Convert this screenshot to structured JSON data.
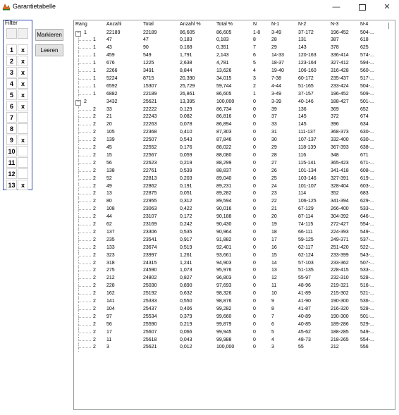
{
  "window": {
    "title": "Garantietabelle",
    "minimize": "—",
    "close": "✕"
  },
  "filter": {
    "caption": "Filter",
    "rows": [
      {
        "num": "1",
        "mark": "x"
      },
      {
        "num": "2",
        "mark": "x"
      },
      {
        "num": "3",
        "mark": "x"
      },
      {
        "num": "4",
        "mark": "x"
      },
      {
        "num": "5",
        "mark": "x"
      },
      {
        "num": "6",
        "mark": "x"
      },
      {
        "num": "7",
        "mark": ""
      },
      {
        "num": "8",
        "mark": ""
      },
      {
        "num": "9",
        "mark": "x"
      },
      {
        "num": "10",
        "mark": ""
      },
      {
        "num": "11",
        "mark": ""
      },
      {
        "num": "12",
        "mark": ""
      },
      {
        "num": "13",
        "mark": "x"
      }
    ]
  },
  "buttons": {
    "markieren": "Markieren",
    "leeren": "Leeren"
  },
  "table": {
    "columns": [
      "Rang",
      "Anzahl",
      "Total",
      "Anzahl %",
      "Total %",
      "N",
      "N-1",
      "N-2",
      "N-3",
      "N-4"
    ],
    "rows": [
      {
        "level": 0,
        "exp": "-",
        "rang": "1",
        "anzahl": "22189",
        "total": "22189",
        "ap": "86,605",
        "tp": "86,605",
        "n": "1-8",
        "n1": "3-49",
        "n2": "37-172",
        "n3": "196-452",
        "n4": "504-..."
      },
      {
        "level": 1,
        "rang": "1",
        "anzahl": "47",
        "total": "47",
        "ap": "0,183",
        "tp": "0,183",
        "n": "8",
        "n1": "28",
        "n2": "131",
        "n3": "387",
        "n4": "618"
      },
      {
        "level": 1,
        "rang": "1",
        "anzahl": "43",
        "total": "90",
        "ap": "0,168",
        "tp": "0,351",
        "n": "7",
        "n1": "29",
        "n2": "143",
        "n3": "378",
        "n4": "625"
      },
      {
        "level": 1,
        "rang": "1",
        "anzahl": "459",
        "total": "549",
        "ap": "1,791",
        "tp": "2,143",
        "n": "6",
        "n1": "14-33",
        "n2": "120-163",
        "n3": "336-414",
        "n4": "574-..."
      },
      {
        "level": 1,
        "rang": "1",
        "anzahl": "676",
        "total": "1225",
        "ap": "2,638",
        "tp": "4,781",
        "n": "5",
        "n1": "18-37",
        "n2": "123-164",
        "n3": "327-412",
        "n4": "594-..."
      },
      {
        "level": 1,
        "rang": "1",
        "anzahl": "2266",
        "total": "3491",
        "ap": "8,844",
        "tp": "13,626",
        "n": "4",
        "n1": "19-40",
        "n2": "106-160",
        "n3": "316-428",
        "n4": "560-..."
      },
      {
        "level": 1,
        "rang": "1",
        "anzahl": "5224",
        "total": "8715",
        "ap": "20,390",
        "tp": "34,015",
        "n": "3",
        "n1": "7-38",
        "n2": "60-172",
        "n3": "235-437",
        "n4": "517-..."
      },
      {
        "level": 1,
        "rang": "1",
        "anzahl": "6592",
        "total": "15307",
        "ap": "25,729",
        "tp": "59,744",
        "n": "2",
        "n1": "4-44",
        "n2": "51-165",
        "n3": "233-424",
        "n4": "504-..."
      },
      {
        "level": 1,
        "rang": "1",
        "anzahl": "6882",
        "total": "22189",
        "ap": "26,861",
        "tp": "86,605",
        "n": "1",
        "n1": "3-49",
        "n2": "37-157",
        "n3": "196-452",
        "n4": "509-..."
      },
      {
        "level": 0,
        "exp": "-",
        "rang": "2",
        "anzahl": "3432",
        "total": "25621",
        "ap": "13,395",
        "tp": "100,000",
        "n": "0",
        "n1": "3-39",
        "n2": "40-146",
        "n3": "188-427",
        "n4": "501-..."
      },
      {
        "level": 1,
        "rang": "2",
        "anzahl": "33",
        "total": "22222",
        "ap": "0,129",
        "tp": "86,734",
        "n": "0",
        "n1": "39",
        "n2": "136",
        "n3": "369",
        "n4": "652"
      },
      {
        "level": 1,
        "rang": "2",
        "anzahl": "21",
        "total": "22243",
        "ap": "0,082",
        "tp": "86,816",
        "n": "0",
        "n1": "37",
        "n2": "145",
        "n3": "372",
        "n4": "674"
      },
      {
        "level": 1,
        "rang": "2",
        "anzahl": "20",
        "total": "22263",
        "ap": "0,078",
        "tp": "86,894",
        "n": "0",
        "n1": "33",
        "n2": "145",
        "n3": "396",
        "n4": "634"
      },
      {
        "level": 1,
        "rang": "2",
        "anzahl": "105",
        "total": "22368",
        "ap": "0,410",
        "tp": "87,303",
        "n": "0",
        "n1": "31",
        "n2": "111-137",
        "n3": "368-373",
        "n4": "630-..."
      },
      {
        "level": 1,
        "rang": "2",
        "anzahl": "139",
        "total": "22507",
        "ap": "0,543",
        "tp": "87,846",
        "n": "0",
        "n1": "30",
        "n2": "107-137",
        "n3": "332-400",
        "n4": "630-..."
      },
      {
        "level": 1,
        "rang": "2",
        "anzahl": "45",
        "total": "22552",
        "ap": "0,176",
        "tp": "88,022",
        "n": "0",
        "n1": "29",
        "n2": "118-139",
        "n3": "367-393",
        "n4": "638-..."
      },
      {
        "level": 1,
        "rang": "2",
        "anzahl": "15",
        "total": "22567",
        "ap": "0,059",
        "tp": "88,080",
        "n": "0",
        "n1": "28",
        "n2": "116",
        "n3": "348",
        "n4": "671"
      },
      {
        "level": 1,
        "rang": "2",
        "anzahl": "56",
        "total": "22623",
        "ap": "0,219",
        "tp": "88,299",
        "n": "0",
        "n1": "27",
        "n2": "115-141",
        "n3": "365-423",
        "n4": "671-..."
      },
      {
        "level": 1,
        "rang": "2",
        "anzahl": "138",
        "total": "22761",
        "ap": "0,539",
        "tp": "88,837",
        "n": "0",
        "n1": "26",
        "n2": "101-134",
        "n3": "341-418",
        "n4": "608-..."
      },
      {
        "level": 1,
        "rang": "2",
        "anzahl": "52",
        "total": "22813",
        "ap": "0,203",
        "tp": "89,040",
        "n": "0",
        "n1": "25",
        "n2": "103-146",
        "n3": "327-391",
        "n4": "619-..."
      },
      {
        "level": 1,
        "rang": "2",
        "anzahl": "49",
        "total": "22862",
        "ap": "0,191",
        "tp": "89,231",
        "n": "0",
        "n1": "24",
        "n2": "101-107",
        "n3": "328-404",
        "n4": "603-..."
      },
      {
        "level": 1,
        "rang": "2",
        "anzahl": "13",
        "total": "22875",
        "ap": "0,051",
        "tp": "89,282",
        "n": "0",
        "n1": "23",
        "n2": "114",
        "n3": "352",
        "n4": "683"
      },
      {
        "level": 1,
        "rang": "2",
        "anzahl": "80",
        "total": "22955",
        "ap": "0,312",
        "tp": "89,594",
        "n": "0",
        "n1": "22",
        "n2": "106-125",
        "n3": "341-394",
        "n4": "629-..."
      },
      {
        "level": 1,
        "rang": "2",
        "anzahl": "108",
        "total": "23063",
        "ap": "0,422",
        "tp": "90,016",
        "n": "0",
        "n1": "21",
        "n2": "67-129",
        "n3": "266-400",
        "n4": "533-..."
      },
      {
        "level": 1,
        "rang": "2",
        "anzahl": "44",
        "total": "23107",
        "ap": "0,172",
        "tp": "90,188",
        "n": "0",
        "n1": "20",
        "n2": "87-114",
        "n3": "304-392",
        "n4": "646-..."
      },
      {
        "level": 1,
        "rang": "2",
        "anzahl": "62",
        "total": "23169",
        "ap": "0,242",
        "tp": "90,430",
        "n": "0",
        "n1": "19",
        "n2": "74-115",
        "n3": "272-427",
        "n4": "554-..."
      },
      {
        "level": 1,
        "rang": "2",
        "anzahl": "137",
        "total": "23306",
        "ap": "0,535",
        "tp": "90,964",
        "n": "0",
        "n1": "18",
        "n2": "66-111",
        "n3": "224-393",
        "n4": "549-..."
      },
      {
        "level": 1,
        "rang": "2",
        "anzahl": "235",
        "total": "23541",
        "ap": "0,917",
        "tp": "91,882",
        "n": "0",
        "n1": "17",
        "n2": "59-125",
        "n3": "249-371",
        "n4": "537-..."
      },
      {
        "level": 1,
        "rang": "2",
        "anzahl": "133",
        "total": "23674",
        "ap": "0,519",
        "tp": "92,401",
        "n": "0",
        "n1": "16",
        "n2": "62-117",
        "n3": "251-420",
        "n4": "522-..."
      },
      {
        "level": 1,
        "rang": "2",
        "anzahl": "323",
        "total": "23997",
        "ap": "1,261",
        "tp": "93,661",
        "n": "0",
        "n1": "15",
        "n2": "62-124",
        "n3": "233-399",
        "n4": "543-..."
      },
      {
        "level": 1,
        "rang": "2",
        "anzahl": "318",
        "total": "24315",
        "ap": "1,241",
        "tp": "94,903",
        "n": "0",
        "n1": "14",
        "n2": "57-103",
        "n3": "233-362",
        "n4": "507-..."
      },
      {
        "level": 1,
        "rang": "2",
        "anzahl": "275",
        "total": "24590",
        "ap": "1,073",
        "tp": "95,976",
        "n": "0",
        "n1": "13",
        "n2": "51-135",
        "n3": "228-415",
        "n4": "533-..."
      },
      {
        "level": 1,
        "rang": "2",
        "anzahl": "212",
        "total": "24802",
        "ap": "0,827",
        "tp": "96,803",
        "n": "0",
        "n1": "12",
        "n2": "55-97",
        "n3": "232-310",
        "n4": "528-..."
      },
      {
        "level": 1,
        "rang": "2",
        "anzahl": "228",
        "total": "25030",
        "ap": "0,890",
        "tp": "97,693",
        "n": "0",
        "n1": "11",
        "n2": "48-96",
        "n3": "219-321",
        "n4": "516-..."
      },
      {
        "level": 1,
        "rang": "2",
        "anzahl": "162",
        "total": "25192",
        "ap": "0,632",
        "tp": "98,326",
        "n": "0",
        "n1": "10",
        "n2": "41-89",
        "n3": "215-302",
        "n4": "521-..."
      },
      {
        "level": 1,
        "rang": "2",
        "anzahl": "141",
        "total": "25333",
        "ap": "0,550",
        "tp": "98,876",
        "n": "0",
        "n1": "9",
        "n2": "41-90",
        "n3": "190-300",
        "n4": "536-..."
      },
      {
        "level": 1,
        "rang": "2",
        "anzahl": "104",
        "total": "25437",
        "ap": "0,406",
        "tp": "99,282",
        "n": "0",
        "n1": "8",
        "n2": "41-87",
        "n3": "216-320",
        "n4": "528-..."
      },
      {
        "level": 1,
        "rang": "2",
        "anzahl": "97",
        "total": "25534",
        "ap": "0,379",
        "tp": "99,660",
        "n": "0",
        "n1": "7",
        "n2": "40-89",
        "n3": "190-300",
        "n4": "501-..."
      },
      {
        "level": 1,
        "rang": "2",
        "anzahl": "56",
        "total": "25590",
        "ap": "0,219",
        "tp": "99,879",
        "n": "0",
        "n1": "6",
        "n2": "40-85",
        "n3": "189-286",
        "n4": "529-..."
      },
      {
        "level": 1,
        "rang": "2",
        "anzahl": "17",
        "total": "25607",
        "ap": "0,066",
        "tp": "99,945",
        "n": "0",
        "n1": "5",
        "n2": "45-62",
        "n3": "188-285",
        "n4": "549-..."
      },
      {
        "level": 1,
        "rang": "2",
        "anzahl": "11",
        "total": "25618",
        "ap": "0,043",
        "tp": "99,988",
        "n": "0",
        "n1": "4",
        "n2": "48-73",
        "n3": "218-265",
        "n4": "554-..."
      },
      {
        "level": 1,
        "rang": "2",
        "anzahl": "3",
        "total": "25621",
        "ap": "0,012",
        "tp": "100,000",
        "n": "0",
        "n1": "3",
        "n2": "55",
        "n3": "212",
        "n4": "556"
      }
    ]
  }
}
